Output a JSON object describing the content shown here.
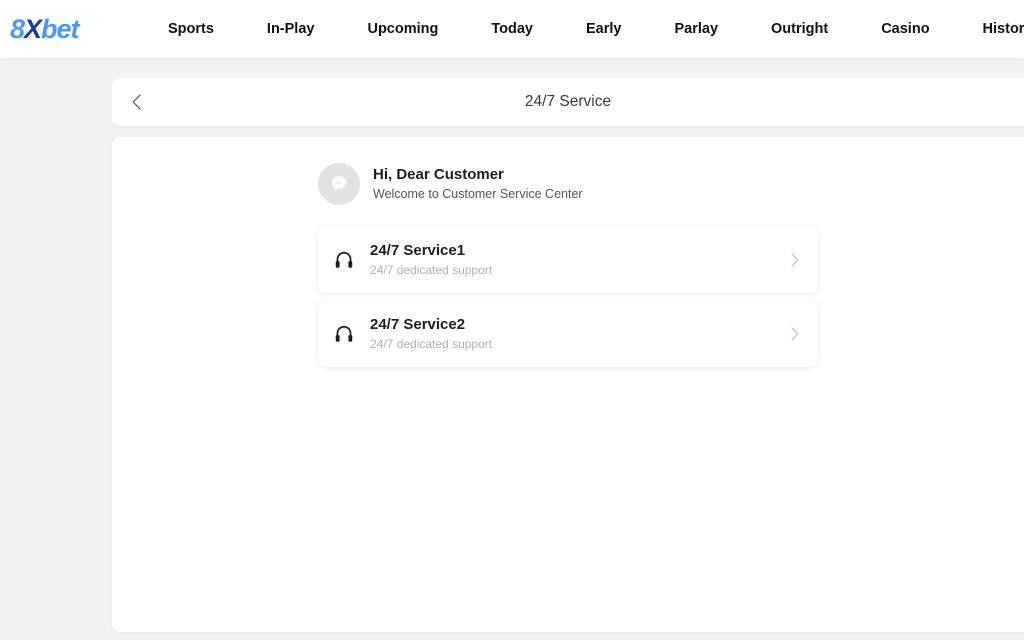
{
  "brand": {
    "part1": "8",
    "part2": "X",
    "part3": "bet"
  },
  "nav": {
    "items": [
      {
        "label": "Sports"
      },
      {
        "label": "In-Play"
      },
      {
        "label": "Upcoming"
      },
      {
        "label": "Today"
      },
      {
        "label": "Early"
      },
      {
        "label": "Parlay"
      },
      {
        "label": "Outright"
      },
      {
        "label": "Casino"
      },
      {
        "label": "History"
      }
    ]
  },
  "header": {
    "title": "24/7 Service",
    "back_icon": "chevron-left-icon"
  },
  "greeting": {
    "avatar_icon": "chat-bubble-smile-icon",
    "title": "Hi, Dear Customer",
    "subtitle": "Welcome to Customer Service Center"
  },
  "services": [
    {
      "icon": "headphones-icon",
      "title": "24/7 Service1",
      "subtitle": "24/7 dedicated support",
      "arrow_icon": "chevron-right-icon"
    },
    {
      "icon": "headphones-icon",
      "title": "24/7 Service2",
      "subtitle": "24/7 dedicated support",
      "arrow_icon": "chevron-right-icon"
    }
  ],
  "colors": {
    "page_background": "#f2f2f2",
    "surface": "#ffffff",
    "brand_light_blue": "#4a9bf0",
    "brand_dark_blue": "#1d3f8f",
    "text_primary": "#1f1f1f",
    "text_muted": "#b0b0b0",
    "avatar_background": "#e2e2e2"
  }
}
